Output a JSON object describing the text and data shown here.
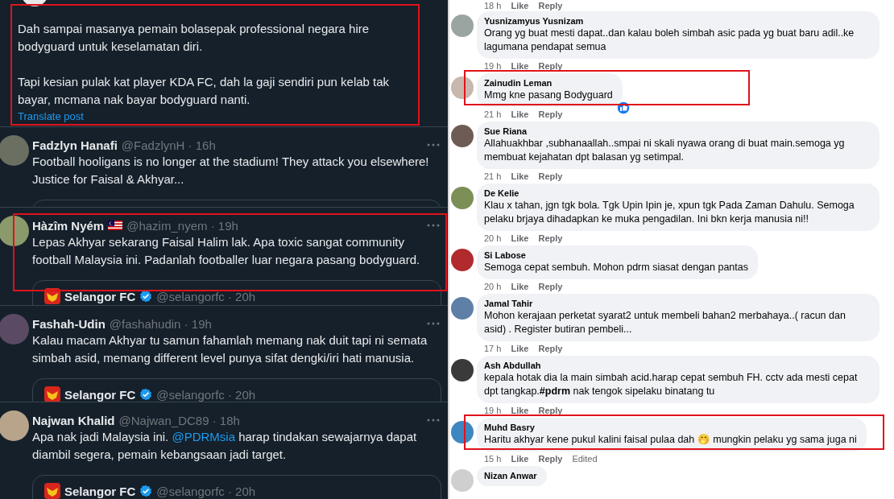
{
  "left_feed": {
    "posts": [
      {
        "kind": "main",
        "paragraphs": [
          "Dah sampai masanya pemain bolasepak professional negara hire bodyguard untuk keselamatan diri.",
          "Tapi kesian pulak kat player KDA FC, dah la gaji sendiri pun kelab tak bayar, mcmana nak bayar bodyguard nanti."
        ],
        "translate": "Translate post",
        "highlighted": true
      },
      {
        "kind": "reply",
        "name": "Fadzlyn Hanafi",
        "flag_icon": false,
        "meta": "@FadzlynH · 16h",
        "text": "Football hooligans is no longer at the stadium! They attack you elsewhere! Justice for Faisal & Akhyar...",
        "highlighted": false
      },
      {
        "kind": "reply",
        "name": "Hàzîm Nyém",
        "flag_icon": true,
        "meta": "@hazim_nyem · 19h",
        "text": "Lepas Akhyar sekarang Faisal Halim lak. Apa toxic sangat community football Malaysia ini. Padanlah footballer luar negara pasang bodyguard.",
        "quote": {
          "name": "Selangor FC",
          "verified": true,
          "meta": "@selangorfc · 20h"
        },
        "highlighted": true
      },
      {
        "kind": "reply",
        "name": "Fashah-Udin",
        "flag_icon": false,
        "meta": "@fashahudin · 19h",
        "text": "Kalau macam Akhyar tu samun fahamlah memang nak duit tapi ni semata simbah asid, memang different level punya sifat dengki/iri hati manusia.",
        "quote": {
          "name": "Selangor FC",
          "verified": true,
          "meta": "@selangorfc · 20h"
        },
        "highlighted": false
      },
      {
        "kind": "reply",
        "name": "Najwan Khalid",
        "flag_icon": false,
        "meta": "@Najwan_DC89 · 18h",
        "text": [
          {
            "text": "Apa nak jadi Malaysia ini. "
          },
          {
            "text": "@PDRMsia",
            "link": true
          },
          {
            "text": " harap tindakan sewajarnya dapat diambil segera, pemain kebangsaan jadi target."
          }
        ],
        "quote": {
          "name": "Selangor FC",
          "verified": true,
          "meta": "@selangorfc · 20h"
        },
        "highlighted": false
      }
    ]
  },
  "comments": {
    "top_actions": {
      "time": "18 h",
      "like": "Like",
      "reply": "Reply"
    },
    "items": [
      {
        "name": "Yusnizamyus Yusnizam",
        "text": "Orang yg buat mesti dapat..dan kalau boleh simbah asic pada yg buat baru adil..ke lagumana pendapat semua",
        "time": "19 h",
        "like": "Like",
        "reply": "Reply",
        "reaction": false,
        "highlighted": false
      },
      {
        "name": "Zainudin Leman",
        "text": "Mmg kne pasang Bodyguard",
        "time": "21 h",
        "like": "Like",
        "reply": "Reply",
        "reaction": true,
        "highlighted": true
      },
      {
        "name": "Sue Riana",
        "text": "Allahuakhbar ,subhanaallah..smpai ni skali nyawa orang di buat main.semoga yg membuat kejahatan dpt balasan yg setimpal.",
        "time": "21 h",
        "like": "Like",
        "reply": "Reply",
        "reaction": false,
        "highlighted": false
      },
      {
        "name": "De Kelie",
        "text": "Klau x tahan, jgn tgk bola. Tgk Upin Ipin je, xpun tgk Pada Zaman Dahulu. Semoga pelaku brjaya dihadapkan ke muka pengadilan. Ini bkn kerja manusia ni!!",
        "time": "20 h",
        "like": "Like",
        "reply": "Reply",
        "reaction": false,
        "highlighted": false
      },
      {
        "name": "Si Labose",
        "text": "Semoga cepat sembuh. Mohon pdrm siasat dengan pantas",
        "time": "20 h",
        "like": "Like",
        "reply": "Reply",
        "reaction": false,
        "highlighted": false
      },
      {
        "name": "Jamal Tahir",
        "text": "Mohon kerajaan perketat syarat2 untuk membeli bahan2 merbahaya..( racun dan asid) . Register butiran pembeli...",
        "time": "17 h",
        "like": "Like",
        "reply": "Reply",
        "reaction": false,
        "highlighted": false
      },
      {
        "name": "Ash Abdullah",
        "text": "kepala hotak dia la main simbah acid.harap cepat sembuh FH. cctv ada mesti cepat dpt tangkap.**#pdrm** nak tengok sipelaku binatang tu",
        "time": "19 h",
        "like": "Like",
        "reply": "Reply",
        "reaction": false,
        "highlighted": false
      },
      {
        "name": "Muhd Basry",
        "text": "Haritu akhyar kene pukul kalini faisal pulaa dah 🤭 mungkin pelaku yg sama juga ni",
        "time": "15 h",
        "like": "Like",
        "reply": "Reply",
        "edited": "Edited",
        "reaction": false,
        "highlighted": true
      },
      {
        "name": "Nizan Anwar",
        "reaction": false,
        "highlighted": false
      }
    ]
  }
}
